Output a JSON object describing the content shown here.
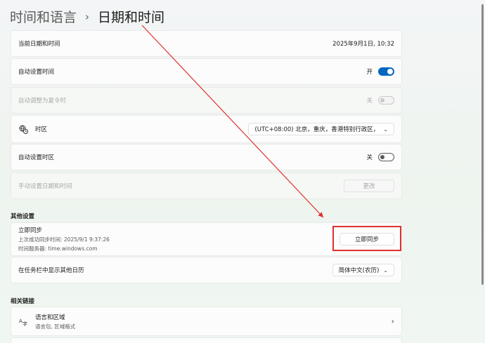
{
  "breadcrumb": {
    "parent": "时间和语言",
    "separator": "›",
    "current": "日期和时间"
  },
  "rows": {
    "current_datetime": {
      "label": "当前日期和时间",
      "value": "2025年9月1日, 10:32"
    },
    "auto_time": {
      "label": "自动设置时间",
      "state": "开",
      "toggle": "on"
    },
    "dst": {
      "label": "自动调整为夏令时",
      "state": "关",
      "toggle": "disabled"
    },
    "timezone": {
      "label": "时区",
      "value": "(UTC+08:00) 北京，重庆，香港特别行政区，",
      "icon": "globe-clock-icon"
    },
    "auto_timezone": {
      "label": "自动设置时区",
      "state": "关",
      "toggle": "off"
    },
    "manual": {
      "label": "手动设置日期和时间",
      "button": "更改"
    }
  },
  "other_settings": {
    "heading": "其他设置",
    "sync": {
      "title": "立即同步",
      "last_sync": "上次成功同步时间: 2025/9/1 9:37:26",
      "server": "时间服务器: time.windows.com",
      "button": "立即同步"
    },
    "calendar": {
      "label": "在任务栏中显示其他日历",
      "value": "简体中文(农历)"
    }
  },
  "related_links": {
    "heading": "相关链接",
    "language_region": {
      "title": "语言和区域",
      "subtitle": "语言包, 区域格式",
      "icon": "language-region-icon"
    }
  },
  "colors": {
    "accent": "#0067c0",
    "annotation": "#e03030"
  }
}
